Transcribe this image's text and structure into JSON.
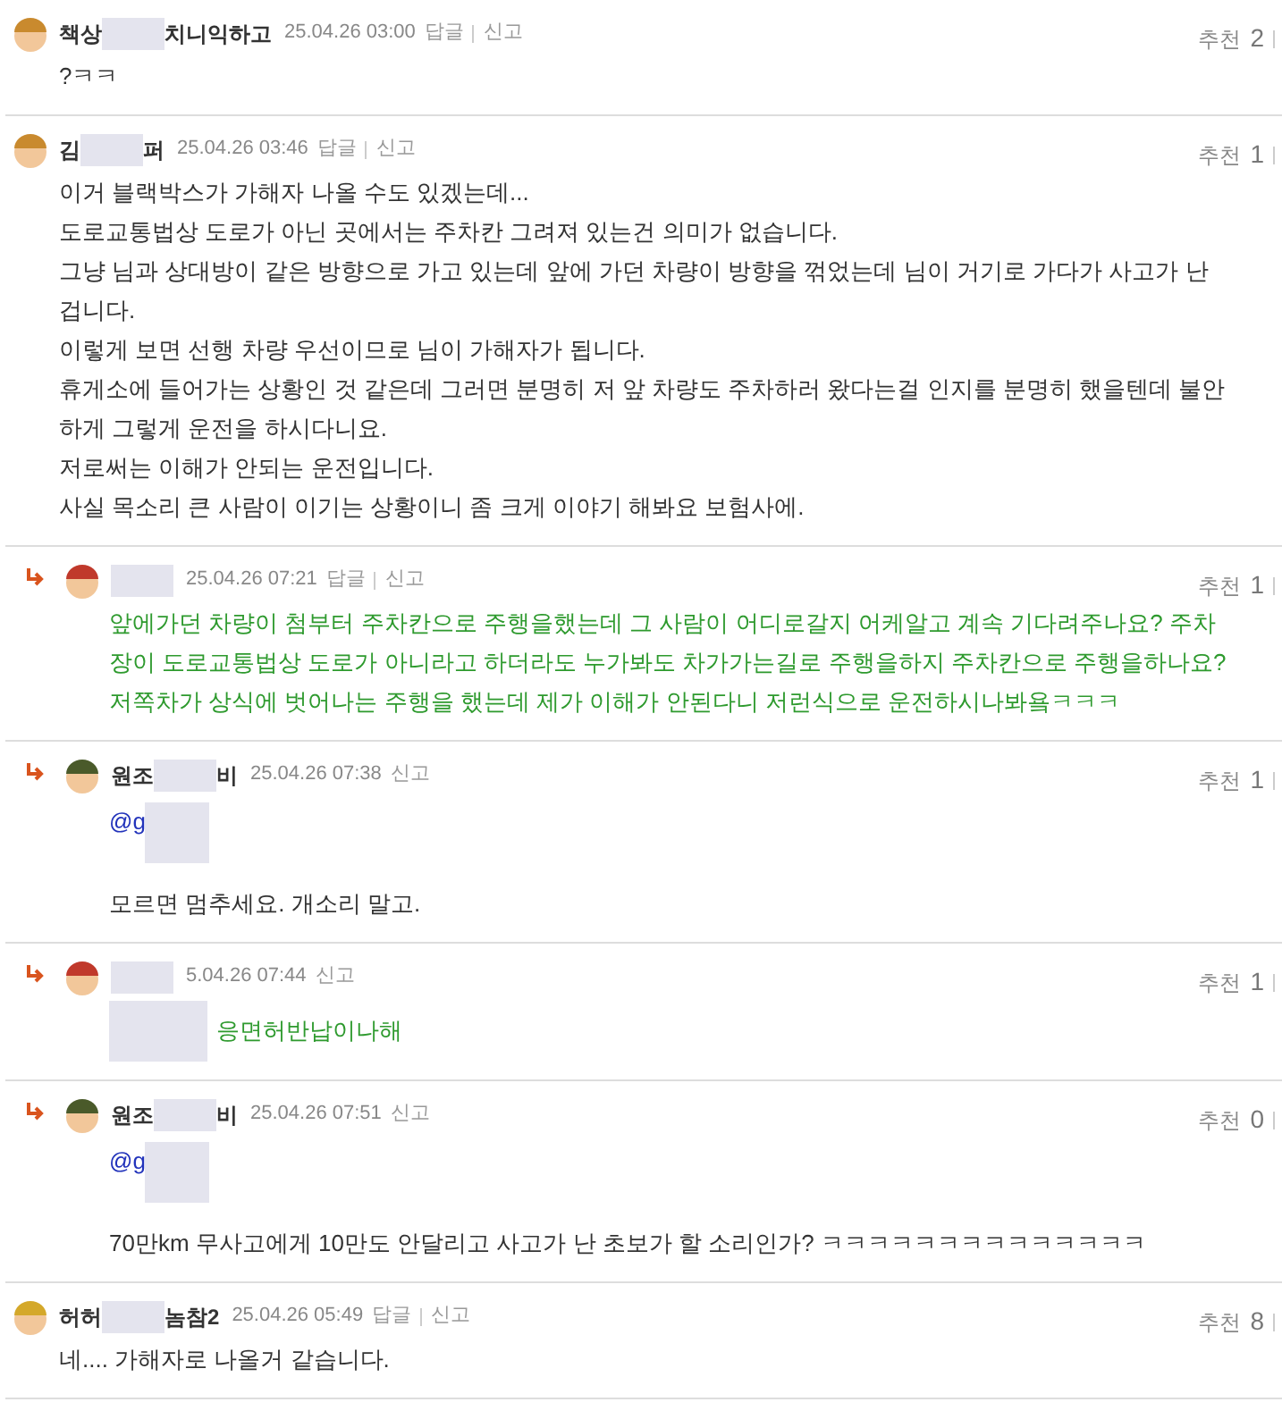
{
  "comments": [
    {
      "reply": false,
      "avatar": {
        "kind": "helmet"
      },
      "name": [
        {
          "kind": "text",
          "text": "책상"
        },
        {
          "kind": "blur"
        },
        {
          "kind": "text",
          "text": "치니익하고"
        }
      ],
      "date": "25.04.26 03:00",
      "reply_label": "답글",
      "report": "신고",
      "recommend_label": "추천",
      "recommend_count": "2",
      "color": "#333333",
      "lines": [
        "?ㅋㅋ"
      ]
    },
    {
      "reply": false,
      "avatar": {
        "kind": "helmet"
      },
      "name": [
        {
          "kind": "text",
          "text": "김"
        },
        {
          "kind": "blur"
        },
        {
          "kind": "text",
          "text": "퍼"
        }
      ],
      "date": "25.04.26 03:46",
      "reply_label": "답글",
      "report": "신고",
      "recommend_label": "추천",
      "recommend_count": "1",
      "color": "#333333",
      "lines": [
        "이거 블랙박스가 가해자 나올 수도 있겠는데...",
        "도로교통법상 도로가 아닌 곳에서는 주차칸 그려져 있는건 의미가 없습니다.",
        "그냥 님과 상대방이 같은 방향으로 가고 있는데 앞에 가던 차량이 방향을 꺾었는데 님이 거기로 가다가 사고가 난",
        "겁니다.",
        "이렇게 보면 선행 차량 우선이므로 님이 가해자가 됩니다.",
        "휴게소에 들어가는 상황인 것 같은데 그러면 분명히 저 앞 차량도 주차하러 왔다는걸 인지를 분명히 했을텐데 불안",
        "하게 그렇게 운전을 하시다니요.",
        "저로써는 이해가 안되는 운전입니다.",
        "사실 목소리 큰 사람이 이기는 상황이니 좀 크게 이야기 해봐요 보험사에."
      ]
    },
    {
      "reply": true,
      "avatar": {
        "kind": "nurse"
      },
      "name": [
        {
          "kind": "blur"
        }
      ],
      "date": "25.04.26 07:21",
      "reply_label": "답글",
      "report": "신고",
      "recommend_label": "추천",
      "recommend_count": "1",
      "color": "#2e9a2e",
      "lines": [
        "앞에가던 차량이 첨부터 주차칸으로 주행을했는데 그 사람이 어디로갈지 어케알고 계속 기다려주나요? 주차",
        "장이 도로교통법상 도로가 아니라고 하더라도 누가봐도 차가가는길로 주행을하지 주차칸으로 주행을하나요?",
        "저쪽차가 상식에 벗어나는 주행을 했는데 제가 이해가 안된다니 저런식으로 운전하시나봐욬ㅋㅋㅋ"
      ]
    },
    {
      "reply": true,
      "avatar": {
        "kind": "army"
      },
      "name": [
        {
          "kind": "text",
          "text": "원조"
        },
        {
          "kind": "blur"
        },
        {
          "kind": "text",
          "text": "비"
        }
      ],
      "date": "25.04.26 07:38",
      "report": "신고",
      "recommend_label": "추천",
      "recommend_count": "1",
      "color": "#333333",
      "mention": "@g",
      "lines": [
        "모르면 멈추세요. 개소리 말고."
      ]
    },
    {
      "reply": true,
      "avatar": {
        "kind": "nurse"
      },
      "name": [
        {
          "kind": "blur"
        }
      ],
      "date": "5.04.26 07:44",
      "report": "신고",
      "recommend_label": "추천",
      "recommend_count": "1",
      "color": "#2e9a2e",
      "body_blur": true,
      "lines": [
        "응면허반납이나해"
      ]
    },
    {
      "reply": true,
      "avatar": {
        "kind": "army"
      },
      "name": [
        {
          "kind": "text",
          "text": "원조"
        },
        {
          "kind": "blur"
        },
        {
          "kind": "text",
          "text": "비"
        }
      ],
      "date": "25.04.26 07:51",
      "report": "신고",
      "recommend_label": "추천",
      "recommend_count": "0",
      "color": "#333333",
      "mention": "@g",
      "lines": [
        "70만km 무사고에게 10만도 안달리고 사고가 난 초보가 할 소리인가? ㅋㅋㅋㅋㅋㅋㅋㅋㅋㅋㅋㅋㅋㅋ"
      ]
    },
    {
      "reply": false,
      "avatar": {
        "kind": "hardhat"
      },
      "name": [
        {
          "kind": "text",
          "text": "허허"
        },
        {
          "kind": "blur"
        },
        {
          "kind": "text",
          "text": "놈참2"
        }
      ],
      "date": "25.04.26 05:49",
      "reply_label": "답글",
      "report": "신고",
      "recommend_label": "추천",
      "recommend_count": "8",
      "color": "#333333",
      "lines": [
        "네.... 가해자로 나올거 같습니다."
      ]
    }
  ]
}
